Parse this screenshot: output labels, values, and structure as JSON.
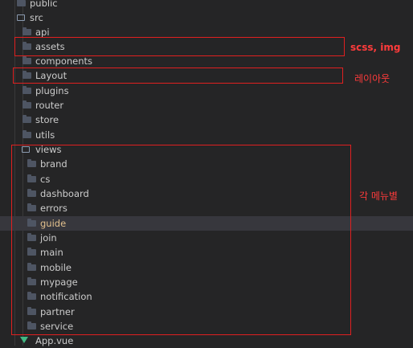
{
  "tree": {
    "public": "public",
    "src": "src",
    "src_children": [
      "api",
      "assets",
      "components",
      "Layout",
      "plugins",
      "router",
      "store",
      "utils"
    ],
    "views": "views",
    "views_children": [
      "brand",
      "cs",
      "dashboard",
      "errors",
      "guide",
      "join",
      "main",
      "mobile",
      "mypage",
      "notification",
      "partner",
      "service"
    ],
    "app_vue": "App.vue"
  },
  "annotations": {
    "assets_note": "scss, img",
    "layout_note": "레이아웃",
    "views_note": "각 메뉴별"
  },
  "colors": {
    "background": "#252526",
    "selected_row": "#37373d",
    "annotation": "#ff3b3b",
    "box_border": "#e02020",
    "modified_text": "#e2c08d",
    "vue_icon": "#41b883"
  }
}
